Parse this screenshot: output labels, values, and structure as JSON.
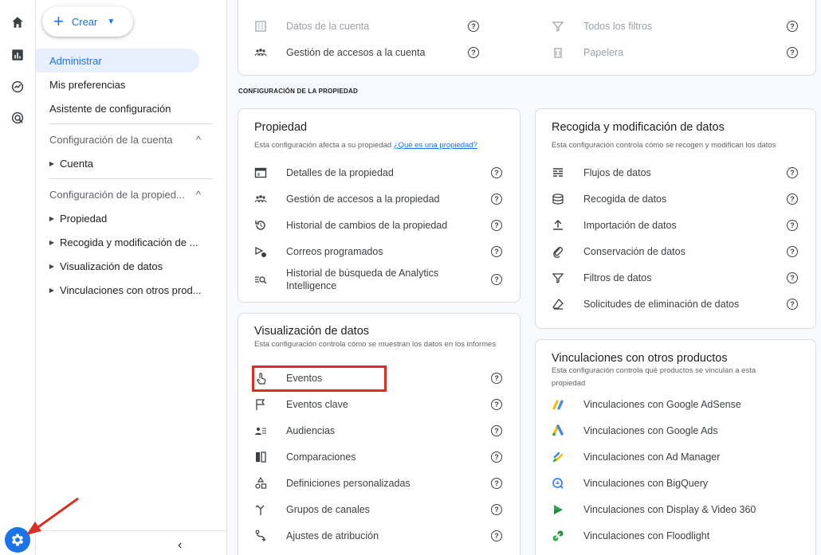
{
  "nav": {
    "create_label": "Crear",
    "items": [
      "Administrar",
      "Mis preferencias",
      "Asistente de configuración"
    ],
    "account_section": "Configuración de la cuenta",
    "account_sub": [
      "Cuenta"
    ],
    "property_section": "Configuración de la propied...",
    "property_sub": [
      "Propiedad",
      "Recogida y modificación de ...",
      "Visualización de datos",
      "Vinculaciones con otros prod..."
    ]
  },
  "account_card": {
    "left_rows": [
      "Datos de la cuenta",
      "Gestión de accesos a la cuenta"
    ],
    "right_rows": [
      "Todos los filtros",
      "Papelera"
    ]
  },
  "section_title": "CONFIGURACIÓN DE LA PROPIEDAD",
  "property_card": {
    "title": "Propiedad",
    "desc": "Esta configuración afecta a su propiedad",
    "link": "¿Qué es una propiedad?",
    "rows": [
      "Detalles de la propiedad",
      "Gestión de accesos a la propiedad",
      "Historial de cambios de la propiedad",
      "Correos programados",
      "Historial de búsqueda de Analytics Intelligence"
    ]
  },
  "data_collection_card": {
    "title": "Recogida y modificación de datos",
    "desc": "Esta configuración controla cómo se recogen y modifican los datos",
    "rows": [
      "Flujos de datos",
      "Recogida de datos",
      "Importación de datos",
      "Conservación de datos",
      "Filtros de datos",
      "Solicitudes de eliminación de datos"
    ]
  },
  "display_card": {
    "title": "Visualización de datos",
    "desc": "Esta configuración controla cómo se muestran los datos en los informes",
    "rows": [
      "Eventos",
      "Eventos clave",
      "Audiencias",
      "Comparaciones",
      "Definiciones personalizadas",
      "Grupos de canales",
      "Ajustes de atribución"
    ]
  },
  "links_card": {
    "title": "Vinculaciones con otros productos",
    "desc": "Esta configuración controla qué productos se vinculan a esta propiedad",
    "rows": [
      "Vinculaciones con Google AdSense",
      "Vinculaciones con Google Ads",
      "Vinculaciones con Ad Manager",
      "Vinculaciones con BigQuery",
      "Vinculaciones con Display & Video 360",
      "Vinculaciones con Floodlight"
    ]
  },
  "colors": {
    "accent": "#1a73e8",
    "highlight": "#d93025"
  }
}
